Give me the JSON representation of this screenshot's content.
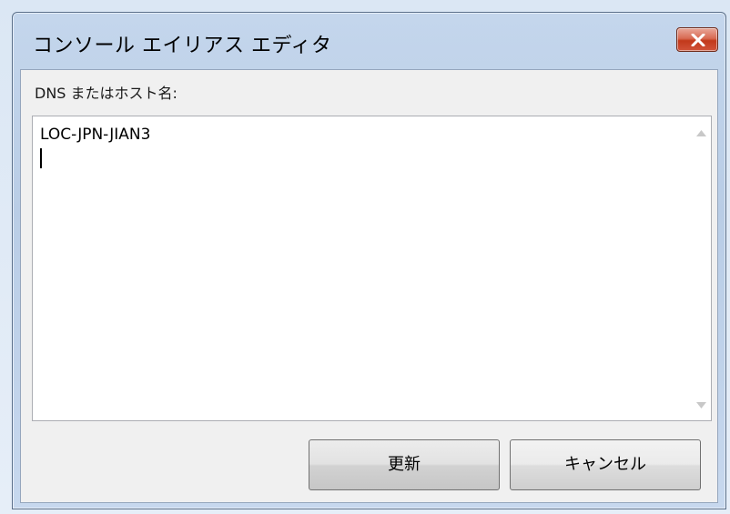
{
  "window": {
    "title": "コンソール エイリアス エディタ",
    "close_icon": "close-icon"
  },
  "form": {
    "label": "DNS またはホスト名:",
    "value": "LOC-JPN-JIAN3"
  },
  "buttons": {
    "update_label": "更新",
    "cancel_label": "キャンセル"
  },
  "colors": {
    "close_button": "#c2391b",
    "window_frame": "#b9cde6",
    "content_bg": "#f0f0f0"
  }
}
